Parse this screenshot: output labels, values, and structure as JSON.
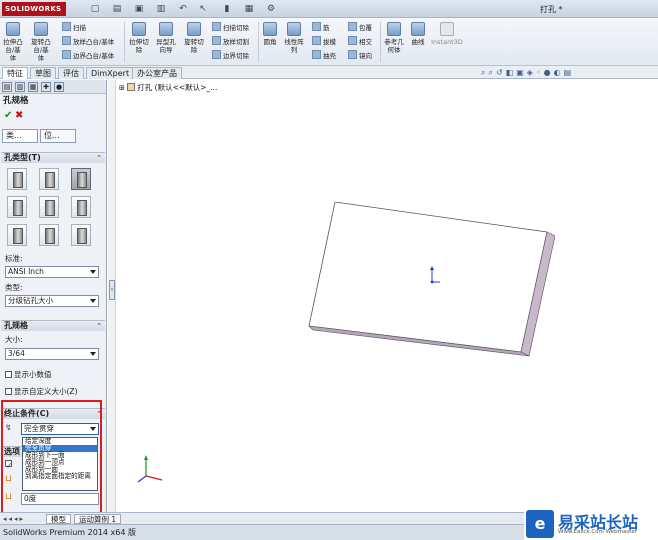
{
  "app": {
    "logo_text": "SOLIDWORKS",
    "window_title": "打孔 *"
  },
  "ribbon": {
    "extrude_boss": "拉伸凸\n台/基\n体",
    "revolve_boss": "旋转凸\n台/基\n体",
    "sweep": "扫描",
    "loft_boss": "放样凸台/基体",
    "boundary_boss": "边界凸台/基体",
    "extrude_cut": "拉伸切\n除",
    "hole_wizard": "异型孔\n向导",
    "revolve_cut": "旋转切\n除",
    "swept_cut": "扫描切除",
    "lofted_cut": "放样切割",
    "boundary_cut": "边界切除",
    "fillet": "圆角",
    "linear_pattern": "线性阵\n列",
    "rib": "筋",
    "draft": "拔模",
    "shell": "抽壳",
    "wrap": "包覆",
    "intersect": "相交",
    "mirror": "镜向",
    "reference_geometry": "参考几\n何体",
    "curves": "曲线",
    "instant3d": "Instant3D"
  },
  "cm_tabs": [
    "特征",
    "草图",
    "评估",
    "DimXpert",
    "办公室产品"
  ],
  "pm": {
    "title": "孔规格",
    "tab_type": "类...",
    "tab_position": "位...",
    "section_hole_type": "孔类型(T)",
    "standard_label": "标准:",
    "standard_value": "ANSI Inch",
    "type_label": "类型:",
    "type_value": "分级钻孔大小",
    "section_hole_spec": "孔规格",
    "size_label": "大小:",
    "size_value": "3/64",
    "show_decimal": "显示小数值",
    "show_custom_size": "显示自定义大小(Z)",
    "section_end_condition": "终止条件(C)",
    "end_condition_value": "完全贯穿",
    "end_condition_options": [
      "给定深度",
      "完全贯穿",
      "成形到下一面",
      "成形到一顶点",
      "成形到一面",
      "到离指定面指定的距离"
    ],
    "options_section_partial": "选项",
    "depth_partial": "0度"
  },
  "graphics": {
    "tree_text": "打孔 (默认<<默认>_..."
  },
  "model_tabs": [
    "模型",
    "运动算例 1"
  ],
  "status": {
    "text": "SolidWorks Premium 2014 x64 版"
  },
  "watermark": {
    "logo_char": "e",
    "name": "易采站长站",
    "sub": "Www.Easck.Com Webmaster"
  },
  "colors": {
    "highlight_red": "#e01b1b",
    "selection_blue": "#3377cc",
    "part_face": "#ffffff",
    "part_side": "#c8b8cc"
  }
}
